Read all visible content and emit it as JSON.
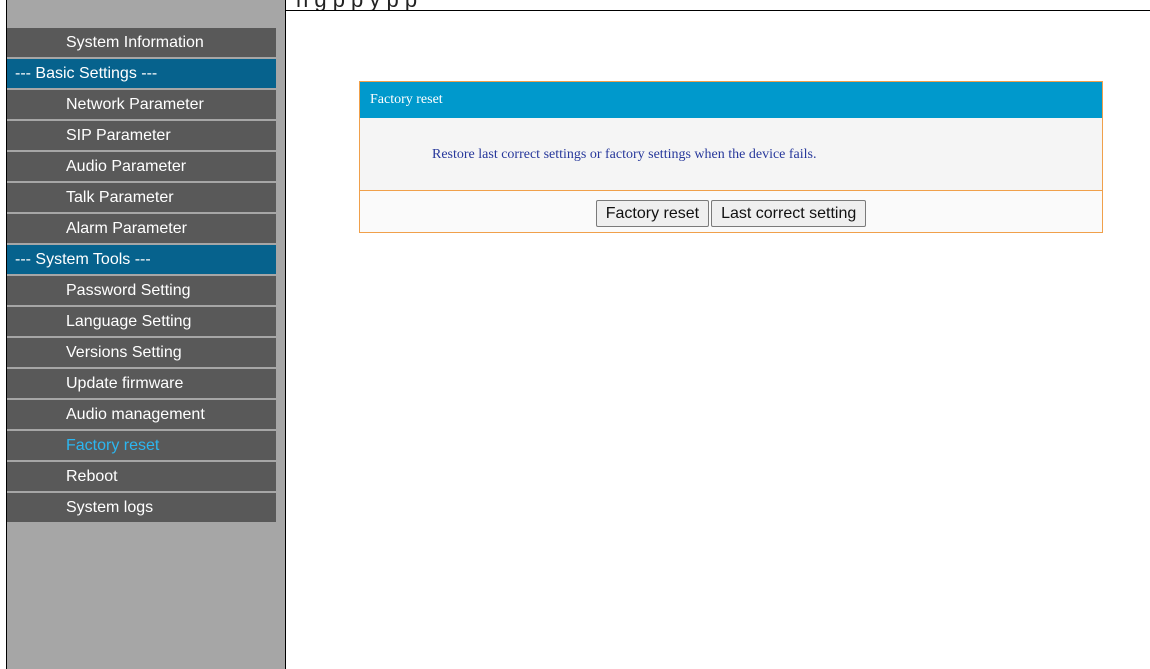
{
  "top_strip_text": "h           g                                                   p    p   y p  p",
  "sidebar": {
    "items": [
      {
        "label": "System Information",
        "type": "item",
        "active": false
      },
      {
        "label": "--- Basic Settings ---",
        "type": "section",
        "active": false
      },
      {
        "label": "Network Parameter",
        "type": "item",
        "active": false
      },
      {
        "label": "SIP Parameter",
        "type": "item",
        "active": false
      },
      {
        "label": "Audio Parameter",
        "type": "item",
        "active": false
      },
      {
        "label": "Talk Parameter",
        "type": "item",
        "active": false
      },
      {
        "label": "Alarm Parameter",
        "type": "item",
        "active": false
      },
      {
        "label": "--- System Tools ---",
        "type": "section",
        "active": false
      },
      {
        "label": "Password Setting",
        "type": "item",
        "active": false
      },
      {
        "label": "Language Setting",
        "type": "item",
        "active": false
      },
      {
        "label": "Versions Setting",
        "type": "item",
        "active": false
      },
      {
        "label": "Update firmware",
        "type": "item",
        "active": false
      },
      {
        "label": "Audio management",
        "type": "item",
        "active": false
      },
      {
        "label": "Factory reset",
        "type": "item",
        "active": true
      },
      {
        "label": "Reboot",
        "type": "item",
        "active": false
      },
      {
        "label": "System logs",
        "type": "item",
        "active": false
      }
    ]
  },
  "panel": {
    "title": "Factory reset",
    "message": "Restore last correct settings or factory settings when the device fails.",
    "buttons": {
      "factory_reset": "Factory reset",
      "last_correct": "Last correct setting"
    }
  },
  "colors": {
    "sidebar_bg": "#a6a6a6",
    "nav_item_bg": "#595959",
    "section_bg": "#06628d",
    "active_text": "#2cb6f0",
    "panel_header": "#0099cc",
    "panel_border": "#f0a04b",
    "message_text": "#27389b"
  }
}
